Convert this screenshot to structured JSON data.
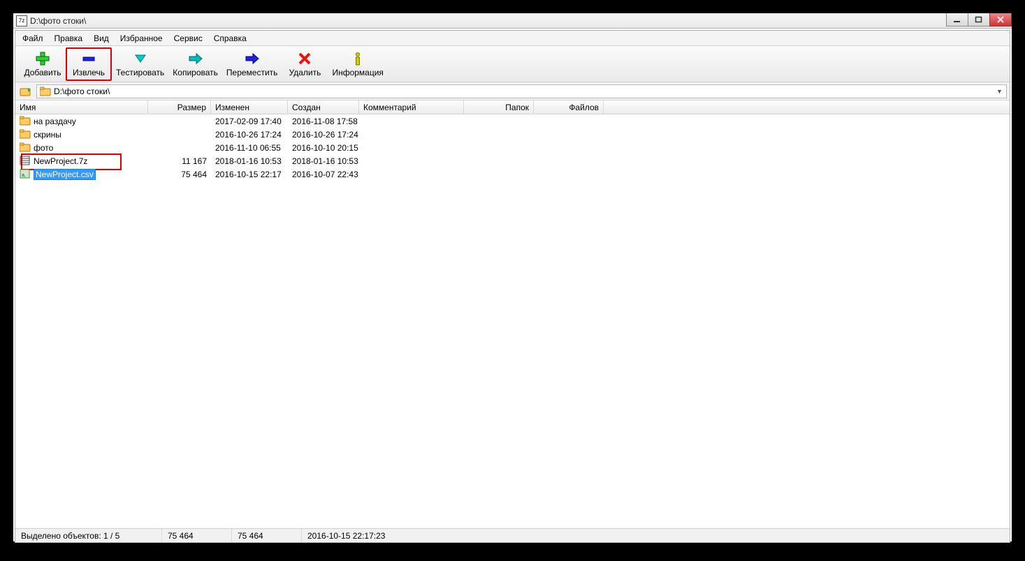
{
  "window": {
    "title": "D:\\фото стоки\\",
    "app_icon_label": "7z"
  },
  "menu": {
    "file": "Файл",
    "edit": "Правка",
    "view": "Вид",
    "favorites": "Избранное",
    "tools": "Сервис",
    "help": "Справка"
  },
  "toolbar": {
    "add": "Добавить",
    "extract": "Извлечь",
    "test": "Тестировать",
    "copy": "Копировать",
    "move": "Переместить",
    "delete": "Удалить",
    "info": "Информация"
  },
  "address": {
    "path": "D:\\фото стоки\\"
  },
  "columns": {
    "name": "Имя",
    "size": "Размер",
    "modified": "Изменен",
    "created": "Создан",
    "comment": "Комментарий",
    "folders": "Папок",
    "files": "Файлов"
  },
  "rows": [
    {
      "type": "folder",
      "name": "на раздачу",
      "size": "",
      "modified": "2017-02-09 17:40",
      "created": "2016-11-08 17:58"
    },
    {
      "type": "folder",
      "name": "скрины",
      "size": "",
      "modified": "2016-10-26 17:24",
      "created": "2016-10-26 17:24"
    },
    {
      "type": "folder",
      "name": "фото",
      "size": "",
      "modified": "2016-11-10 06:55",
      "created": "2016-10-10 20:15"
    },
    {
      "type": "archive",
      "name": "NewProject.7z",
      "size": "11 167",
      "modified": "2018-01-16 10:53",
      "created": "2018-01-16 10:53",
      "highlighted": true
    },
    {
      "type": "csv",
      "name": "NewProject.csv",
      "size": "75 464",
      "modified": "2016-10-15 22:17",
      "created": "2016-10-07 22:43",
      "selected": true
    }
  ],
  "status": {
    "selection": "Выделено объектов: 1 / 5",
    "size1": "75 464",
    "size2": "75 464",
    "time": "2016-10-15 22:17:23"
  },
  "colors": {
    "highlight_border": "#d00",
    "selection_bg": "#3399ff"
  }
}
